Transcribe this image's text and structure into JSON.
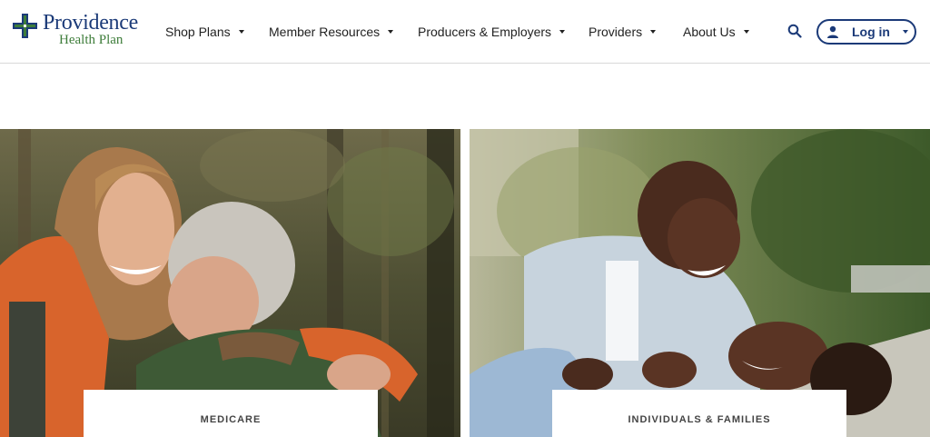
{
  "brand": {
    "name": "Providence",
    "sub": "Health Plan",
    "primary_color": "#1b3a78",
    "accent_color": "#3e7d3a"
  },
  "nav": [
    {
      "label": "Shop Plans"
    },
    {
      "label": "Member Resources"
    },
    {
      "label": "Producers & Employers"
    },
    {
      "label": "Providers"
    },
    {
      "label": "About Us"
    }
  ],
  "header_icons": {
    "search": "search-icon",
    "user": "user-icon"
  },
  "login": {
    "label": "Log in"
  },
  "cards": [
    {
      "label": "MEDICARE",
      "image": "two smiling women hugging outdoors"
    },
    {
      "label": "INDIVIDUALS & FAMILIES",
      "image": "father playing with child outdoors"
    }
  ]
}
